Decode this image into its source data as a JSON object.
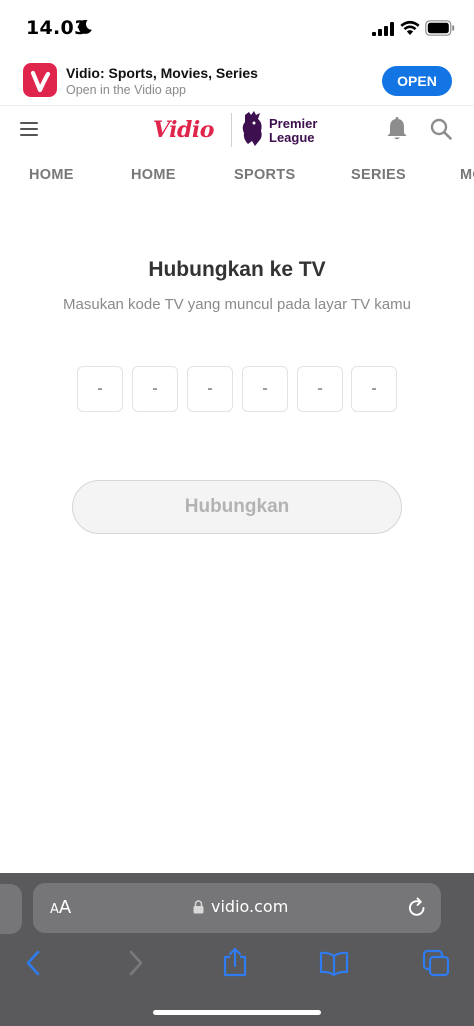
{
  "status_bar": {
    "time": "14.03"
  },
  "app_banner": {
    "title": "Vidio: Sports, Movies, Series",
    "subtitle": "Open in the Vidio app",
    "open_label": "OPEN"
  },
  "header": {
    "brand_name": "Vidio",
    "partner_line1": "Premier",
    "partner_line2": "League"
  },
  "nav": {
    "tabs": [
      "HOME",
      "HOME",
      "SPORTS",
      "SERIES",
      "MOVIES"
    ]
  },
  "main": {
    "title": "Hubungkan ke TV",
    "description": "Masukan kode TV yang muncul pada layar TV kamu",
    "code_placeholder": [
      "-",
      "-",
      "-",
      "-",
      "-",
      "-"
    ],
    "connect_label": "Hubungkan"
  },
  "browser": {
    "aa_big": "A",
    "aa_small": "A",
    "url": "vidio.com"
  },
  "colors": {
    "brand": "#e0254d",
    "open_button": "#1275e3",
    "safari_blue": "#2f7bf0",
    "pl_purple": "#3d0f4e"
  },
  "icons": [
    "moon-icon",
    "signal-icon",
    "wifi-icon",
    "battery-icon",
    "menu-icon",
    "bell-icon",
    "search-icon",
    "lock-icon",
    "reload-icon",
    "back-icon",
    "forward-icon",
    "share-icon",
    "bookmarks-icon",
    "tabs-icon"
  ]
}
